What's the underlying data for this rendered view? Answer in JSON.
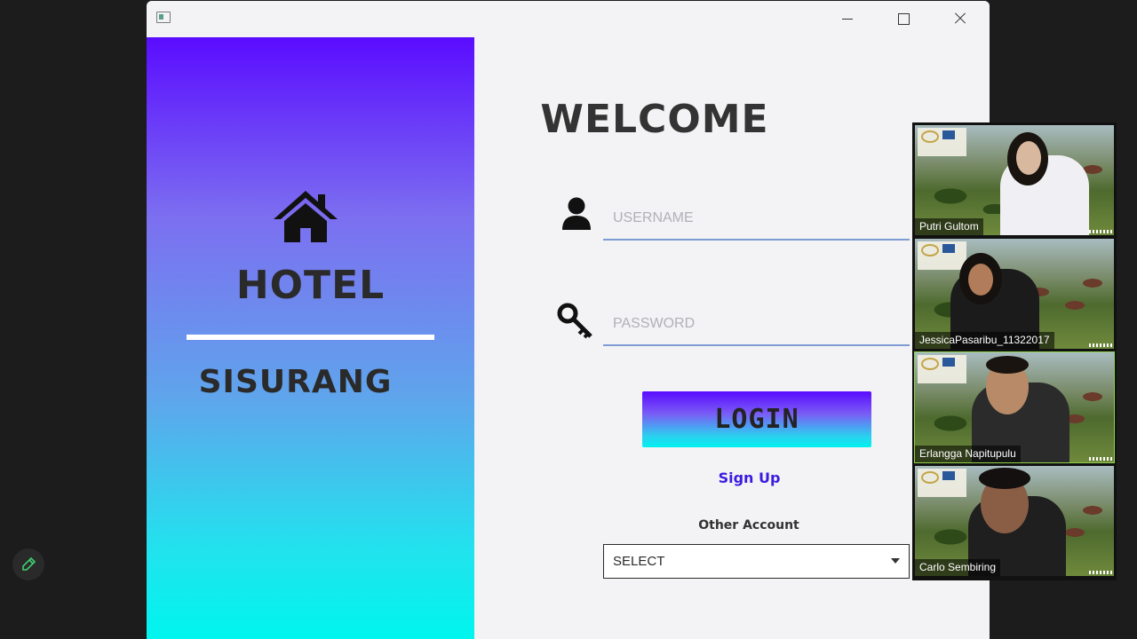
{
  "window": {
    "controls": {
      "minimize": "minimize-icon",
      "maximize": "maximize-icon",
      "close": "close-icon"
    }
  },
  "left_panel": {
    "icon": "house-icon",
    "title": "HOTEL",
    "subtitle": "SISURANG",
    "colors": {
      "gradient_top": "#5a0cff",
      "gradient_bottom": "#00f5ee"
    }
  },
  "form": {
    "heading": "WELCOME",
    "username": {
      "icon": "user-icon",
      "placeholder": "USERNAME",
      "value": ""
    },
    "password": {
      "icon": "key-icon",
      "placeholder": "PASSWORD",
      "value": ""
    },
    "login_label": "LOGIN",
    "signup_label": "Sign Up",
    "other_account_label": "Other Account",
    "select_value": "SELECT"
  },
  "participants": [
    {
      "name": "Putri Gultom"
    },
    {
      "name": "JessicaPasaribu_11322017"
    },
    {
      "name": "Erlangga Napitupulu"
    },
    {
      "name": "Carlo Sembiring"
    }
  ],
  "annotate_button": {
    "icon": "pencil-icon"
  }
}
